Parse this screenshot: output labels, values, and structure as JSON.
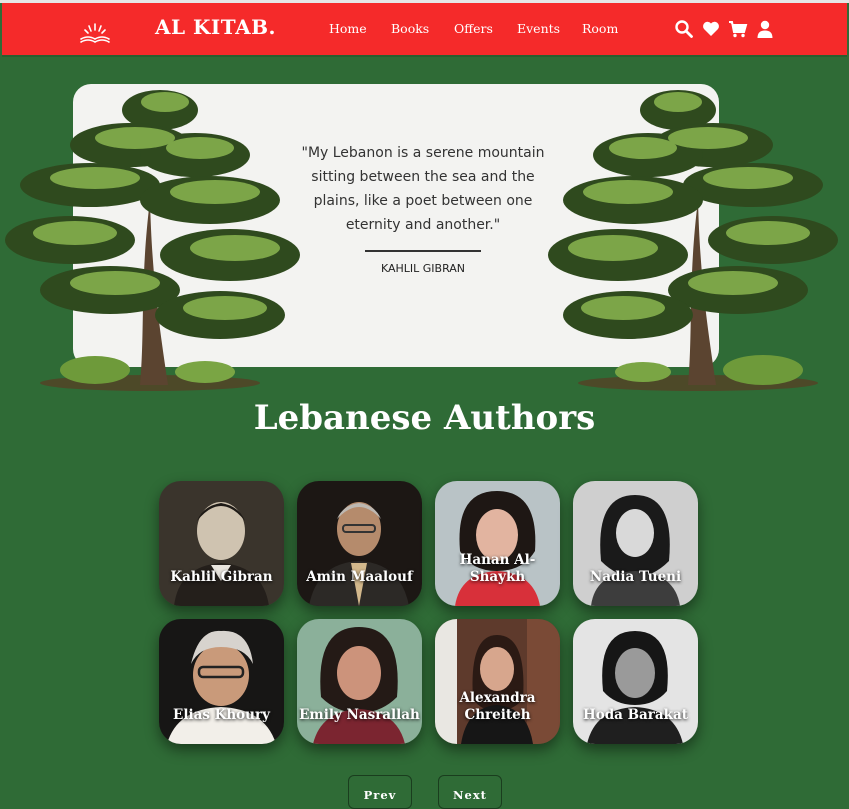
{
  "nav": {
    "brand": "AL KITAB.",
    "links": [
      "Home",
      "Books",
      "Offers",
      "Events",
      "Room"
    ],
    "icons": [
      "search-icon",
      "heart-icon",
      "cart-icon",
      "user-icon"
    ]
  },
  "hero": {
    "quote": "\"My Lebanon is a serene mountain sitting between the sea and the plains, like a poet between one eternity and another.\"",
    "author": "KAHLIL GIBRAN"
  },
  "section": {
    "title": "Lebanese Authors"
  },
  "authors": [
    {
      "name": "Kahlil Gibran"
    },
    {
      "name": "Amin Maalouf"
    },
    {
      "name": "Hanan Al-Shaykh"
    },
    {
      "name": "Nadia Tueni"
    },
    {
      "name": "Elias Khoury"
    },
    {
      "name": "Emily Nasrallah"
    },
    {
      "name": "Alexandra Chreiteh"
    },
    {
      "name": "Hoda Barakat"
    }
  ],
  "pager": {
    "prev": "Prev",
    "next": "Next"
  },
  "colors": {
    "nav": "#f52a2a",
    "background": "#2f6b36",
    "hero": "#f3f3f1"
  }
}
